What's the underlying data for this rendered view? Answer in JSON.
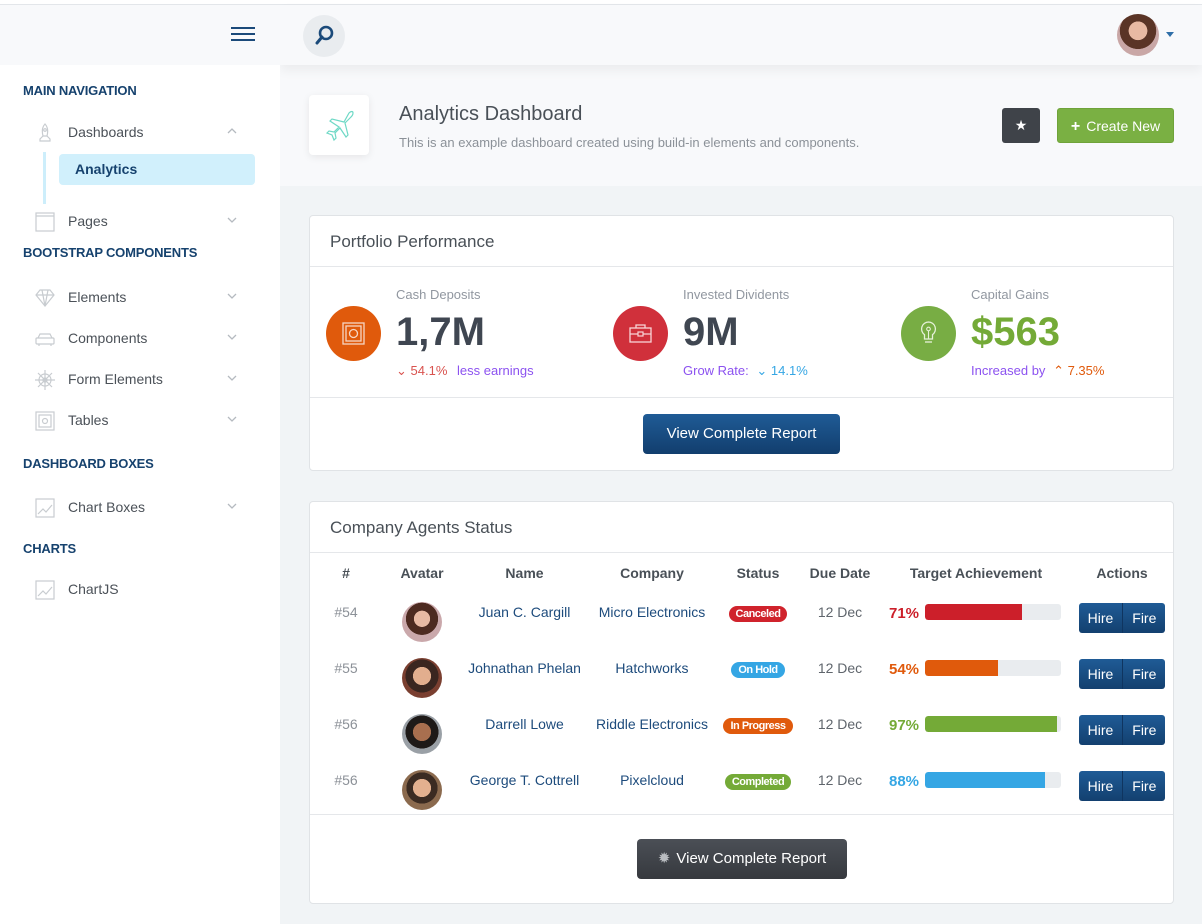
{
  "sidebar": {
    "sections": [
      {
        "heading": "MAIN NAVIGATION"
      },
      {
        "heading": "BOOTSTRAP COMPONENTS"
      },
      {
        "heading": "DASHBOARD BOXES"
      },
      {
        "heading": "CHARTS"
      }
    ],
    "items": {
      "dashboards": {
        "label": "Dashboards",
        "icon": "rocket-icon",
        "expanded": true
      },
      "analytics": {
        "label": "Analytics",
        "active": true
      },
      "pages": {
        "label": "Pages",
        "icon": "browser-icon"
      },
      "elements": {
        "label": "Elements",
        "icon": "diamond-icon"
      },
      "components": {
        "label": "Components",
        "icon": "car-icon"
      },
      "form_elements": {
        "label": "Form Elements",
        "icon": "helm-icon"
      },
      "tables": {
        "label": "Tables",
        "icon": "safe-icon"
      },
      "chart_boxes": {
        "label": "Chart Boxes",
        "icon": "graph-icon"
      },
      "chartjs": {
        "label": "ChartJS",
        "icon": "graph-icon"
      }
    }
  },
  "header": {
    "search_icon": "search-icon",
    "user_avatar": "user-avatar"
  },
  "page": {
    "title": "Analytics Dashboard",
    "subtitle": "This is an example dashboard created using build-in elements and components.",
    "icon": "plane-icon",
    "star_icon": "star-icon",
    "create_label": "Create New",
    "create_icon": "plus-icon"
  },
  "portfolio": {
    "title": "Portfolio Performance",
    "stats": [
      {
        "label": "Cash Deposits",
        "value": "1,7M",
        "icon": "safe-icon",
        "color": "#e05a0c",
        "trend_dir": "down",
        "trend_value": "54.1%",
        "trend_text": "less earnings"
      },
      {
        "label": "Invested Dividents",
        "value": "9M",
        "icon": "briefcase-icon",
        "color": "#d0303b",
        "trend_prefix": "Grow Rate:",
        "trend_dir": "down",
        "trend_value": "14.1%"
      },
      {
        "label": "Capital Gains",
        "value": "$563",
        "icon": "lightbulb-icon",
        "color": "#78ad44",
        "trend_prefix": "Increased by",
        "trend_dir": "up",
        "trend_value": "7.35%"
      }
    ],
    "button_label": "View Complete Report"
  },
  "agents": {
    "title": "Company Agents Status",
    "columns": [
      "#",
      "Avatar",
      "Name",
      "Company",
      "Status",
      "Due Date",
      "Target Achievement",
      "Actions"
    ],
    "rows": [
      {
        "id": "#54",
        "name": "Juan C. Cargill",
        "company": "Micro Electronics",
        "status": "Canceled",
        "status_color": "#d0232c",
        "due": "12 Dec",
        "achievement": 71,
        "achievement_label": "71%",
        "color": "#cc1f2a"
      },
      {
        "id": "#55",
        "name": "Johnathan Phelan",
        "company": "Hatchworks",
        "status": "On Hold",
        "status_color": "#35a6e4",
        "due": "12 Dec",
        "achievement": 54,
        "achievement_label": "54%",
        "color": "#e05a0c"
      },
      {
        "id": "#56",
        "name": "Darrell Lowe",
        "company": "Riddle Electronics",
        "status": "In Progress",
        "status_color": "#e05a0c",
        "due": "12 Dec",
        "achievement": 97,
        "achievement_label": "97%",
        "color": "#74aa37"
      },
      {
        "id": "#56",
        "name": "George T. Cottrell",
        "company": "Pixelcloud",
        "status": "Completed",
        "status_color": "#74aa37",
        "due": "12 Dec",
        "achievement": 88,
        "achievement_label": "88%",
        "color": "#35a6e4"
      }
    ],
    "hire_label": "Hire",
    "fire_label": "Fire",
    "button_label": "View Complete Report",
    "button_icon": "gear-icon"
  }
}
